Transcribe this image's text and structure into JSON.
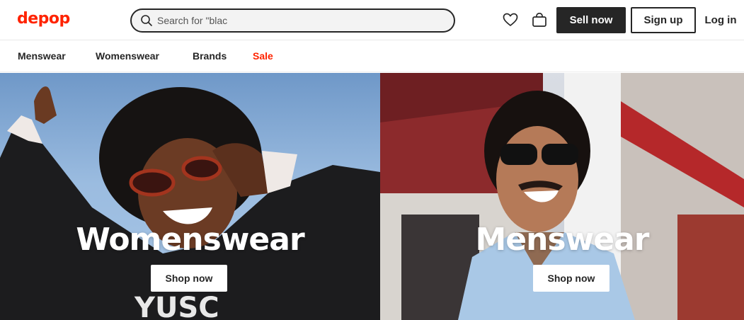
{
  "brand": {
    "logo_text": "depop",
    "color": "#ff2300"
  },
  "search": {
    "value": "",
    "placeholder": "Search for \"blac",
    "icon": "search-icon"
  },
  "header": {
    "favorites_icon": "heart-icon",
    "bag_icon": "bag-icon",
    "sell_label": "Sell now",
    "signup_label": "Sign up",
    "login_label": "Log in"
  },
  "nav": {
    "items": [
      {
        "label": "Menswear"
      },
      {
        "label": "Womenswear"
      },
      {
        "label": "Brands"
      },
      {
        "label": "Sale",
        "color": "#ff2300"
      }
    ]
  },
  "hero": {
    "panels": [
      {
        "title": "Womenswear",
        "cta": "Shop now"
      },
      {
        "title": "Menswear",
        "cta": "Shop now"
      }
    ]
  },
  "colors": {
    "dark": "#262626",
    "accent": "#ff2300"
  }
}
